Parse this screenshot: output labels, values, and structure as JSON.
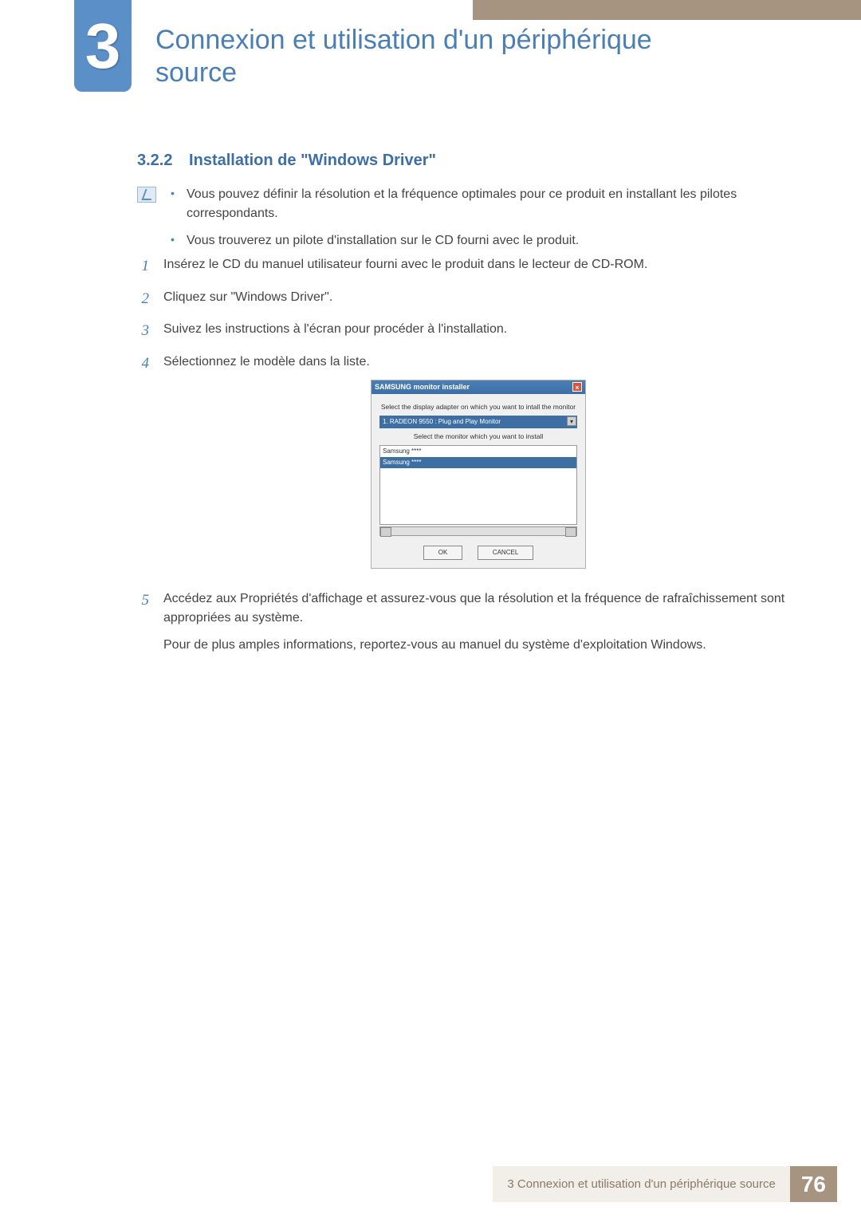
{
  "chapter": {
    "number": "3",
    "title": "Connexion et utilisation d'un périphérique source"
  },
  "section": {
    "number": "3.2.2",
    "title": "Installation de \"Windows Driver\""
  },
  "notes": [
    "Vous pouvez définir la résolution et la fréquence optimales pour ce produit en installant les pilotes correspondants.",
    "Vous trouverez un pilote d'installation sur le CD fourni avec le produit."
  ],
  "steps": {
    "s1": {
      "num": "1",
      "text": "Insérez le CD du manuel utilisateur fourni avec le produit dans le lecteur de CD-ROM."
    },
    "s2": {
      "num": "2",
      "text": "Cliquez sur \"Windows Driver\"."
    },
    "s3": {
      "num": "3",
      "text": "Suivez les instructions à l'écran pour procéder à l'installation."
    },
    "s4": {
      "num": "4",
      "text": "Sélectionnez le modèle dans la liste."
    },
    "s5": {
      "num": "5",
      "text": "Accédez aux Propriétés d'affichage et assurez-vous que la résolution et la fréquence de rafraîchissement sont appropriées au système.",
      "extra": "Pour de plus amples informations, reportez-vous au manuel du système d'exploitation Windows."
    }
  },
  "installer": {
    "title": "SAMSUNG monitor installer",
    "label1": "Select the display adapter on which you want to intall the monitor",
    "select": "1. RADEON 9550 : Plug and Play Monitor",
    "label2": "Select the monitor which you want to install",
    "row1": "Samsung ****",
    "row2": "Samsung ****",
    "ok": "OK",
    "cancel": "CANCEL"
  },
  "footer": {
    "text": "3 Connexion et utilisation d'un périphérique source",
    "page": "76"
  }
}
